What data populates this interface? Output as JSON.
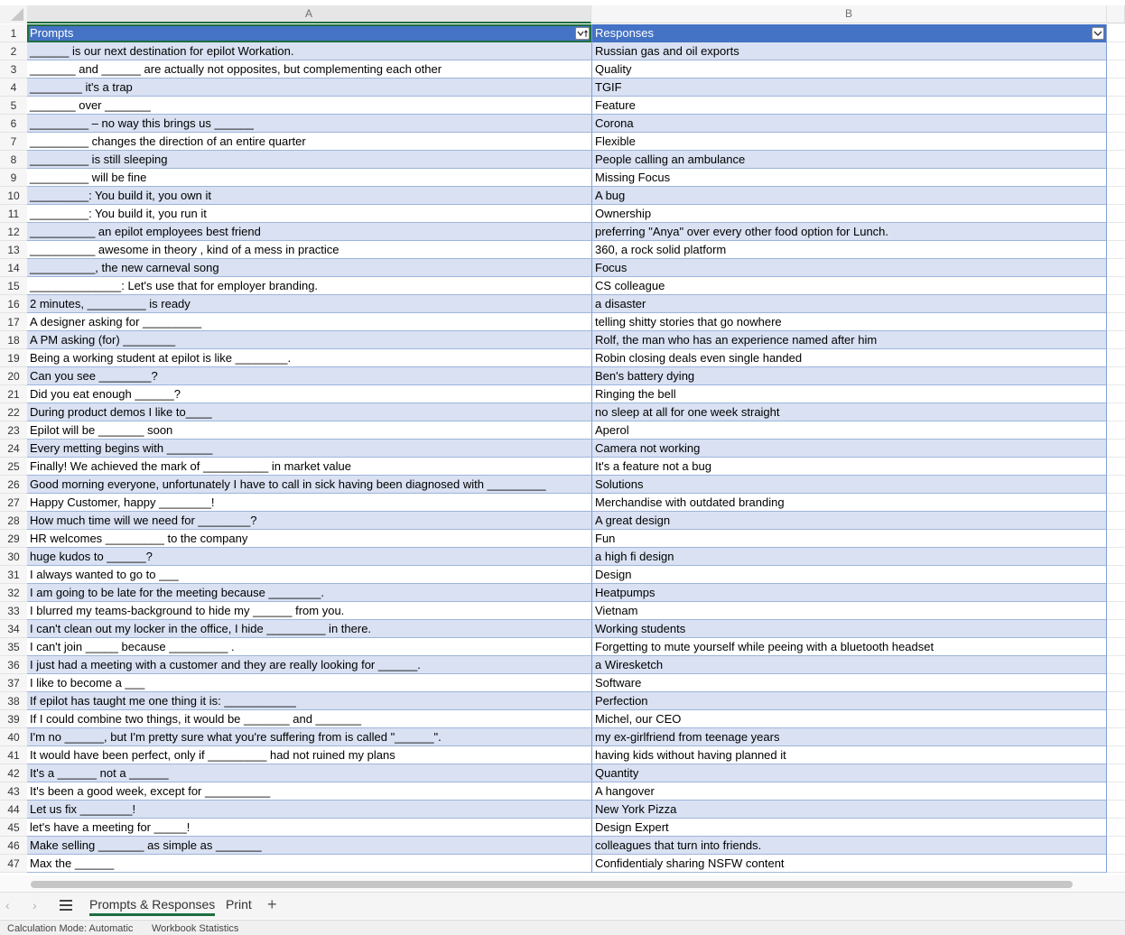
{
  "columns": {
    "a": "A",
    "b": "B"
  },
  "header": {
    "row": "1",
    "a": "Prompts",
    "b": "Responses"
  },
  "rows": [
    {
      "n": "2",
      "a": "______ is our next destination for epilot Workation.",
      "b": "Russian gas and oil exports"
    },
    {
      "n": "3",
      "a": "_______ and ______ are actually not opposites, but complementing each other",
      "b": "Quality"
    },
    {
      "n": "4",
      "a": "________ it's a trap",
      "b": "TGIF"
    },
    {
      "n": "5",
      "a": "_______ over _______",
      "b": "Feature"
    },
    {
      "n": "6",
      "a": "_________ – no way this brings us ______",
      "b": "Corona"
    },
    {
      "n": "7",
      "a": "_________ changes the direction of an entire quarter",
      "b": "Flexible"
    },
    {
      "n": "8",
      "a": "_________ is still sleeping",
      "b": "People calling an ambulance"
    },
    {
      "n": "9",
      "a": "_________ will be fine",
      "b": "Missing Focus"
    },
    {
      "n": "10",
      "a": "_________: You build it, you own it",
      "b": "A bug"
    },
    {
      "n": "11",
      "a": "_________: You build it, you run it",
      "b": "Ownership"
    },
    {
      "n": "12",
      "a": "__________ an epilot employees best friend",
      "b": "preferring \"Anya\" over every other food option for Lunch."
    },
    {
      "n": "13",
      "a": "__________ awesome in theory , kind of a mess in practice",
      "b": "360, a rock solid platform"
    },
    {
      "n": "14",
      "a": "__________, the new carneval song",
      "b": "Focus"
    },
    {
      "n": "15",
      "a": "______________: Let's use that for employer branding.",
      "b": "CS colleague"
    },
    {
      "n": "16",
      "a": "2 minutes, _________ is ready",
      "b": "a disaster"
    },
    {
      "n": "17",
      "a": "A designer asking for _________",
      "b": "telling shitty stories that go nowhere"
    },
    {
      "n": "18",
      "a": "A PM asking (for) ________",
      "b": "Rolf, the man who has an experience named after him"
    },
    {
      "n": "19",
      "a": "Being a working student at epilot is like ________.",
      "b": "Robin closing deals even single handed"
    },
    {
      "n": "20",
      "a": "Can you see ________?",
      "b": "Ben's battery dying"
    },
    {
      "n": "21",
      "a": "Did you eat enough ______?",
      "b": "Ringing the bell"
    },
    {
      "n": "22",
      "a": "During product demos I like to____",
      "b": "no sleep at all for one week straight"
    },
    {
      "n": "23",
      "a": "Epilot will be _______ soon",
      "b": "Aperol"
    },
    {
      "n": "24",
      "a": "Every metting begins with _______",
      "b": "Camera not working"
    },
    {
      "n": "25",
      "a": "Finally! We achieved the mark of __________ in market value",
      "b": "It's a feature not a bug"
    },
    {
      "n": "26",
      "a": "Good morning everyone, unfortunately I have to call in sick having been diagnosed with _________",
      "b": "Solutions"
    },
    {
      "n": "27",
      "a": "Happy Customer, happy ________!",
      "b": "Merchandise with outdated branding"
    },
    {
      "n": "28",
      "a": "How much time will we need for ________?",
      "b": "A great design"
    },
    {
      "n": "29",
      "a": "HR welcomes _________ to the company",
      "b": "Fun"
    },
    {
      "n": "30",
      "a": "huge kudos to ______?",
      "b": "a high fi design"
    },
    {
      "n": "31",
      "a": "I always wanted to go to ___",
      "b": "Design"
    },
    {
      "n": "32",
      "a": "I am going to be late for the meeting because ________.",
      "b": "Heatpumps"
    },
    {
      "n": "33",
      "a": "I blurred my teams-background to hide my ______ from you.",
      "b": "Vietnam"
    },
    {
      "n": "34",
      "a": "I can't clean out my locker in the office, I hide _________ in there.",
      "b": "Working students"
    },
    {
      "n": "35",
      "a": "I can't join _____ because _________ .",
      "b": "Forgetting to mute yourself while peeing with a bluetooth headset"
    },
    {
      "n": "36",
      "a": "I just had a meeting with a customer and they are really looking for ______.",
      "b": "a Wiresketch"
    },
    {
      "n": "37",
      "a": "I like to become a ___",
      "b": "Software"
    },
    {
      "n": "38",
      "a": "If epilot has taught me one thing it is: ___________",
      "b": "Perfection"
    },
    {
      "n": "39",
      "a": "If I could combine two things, it would be _______ and _______",
      "b": "Michel, our CEO"
    },
    {
      "n": "40",
      "a": "I'm no ______, but I'm pretty sure what you're suffering from is called \"______\".",
      "b": "my ex-girlfriend from teenage years"
    },
    {
      "n": "41",
      "a": "It would have been perfect, only if _________ had not ruined my plans",
      "b": "having kids without having planned it"
    },
    {
      "n": "42",
      "a": "It's a ______ not a ______",
      "b": "Quantity"
    },
    {
      "n": "43",
      "a": "It's been a good week, except for __________",
      "b": "A hangover"
    },
    {
      "n": "44",
      "a": "Let us fix ________!",
      "b": "New York Pizza"
    },
    {
      "n": "45",
      "a": "let's have a meeting for _____!",
      "b": "Design Expert"
    },
    {
      "n": "46",
      "a": "Make selling _______ as simple as _______",
      "b": "colleagues that turn into friends."
    },
    {
      "n": "47",
      "a": "Max the ______",
      "b": "Confidentialy sharing NSFW content"
    }
  ],
  "tabs": {
    "active": "Prompts & Responses",
    "print": "Print",
    "add": "+"
  },
  "status": {
    "mode": "Calculation Mode: Automatic",
    "stats": "Workbook Statistics"
  },
  "icons": {
    "prev": "chevron-left-icon",
    "next": "chevron-right-icon",
    "menu": "hamburger-icon",
    "filter": "filter-dropdown-icon"
  },
  "colors": {
    "header_fill": "#4472c4",
    "band_fill": "#d9e1f2",
    "selection": "#1e6e3f"
  }
}
